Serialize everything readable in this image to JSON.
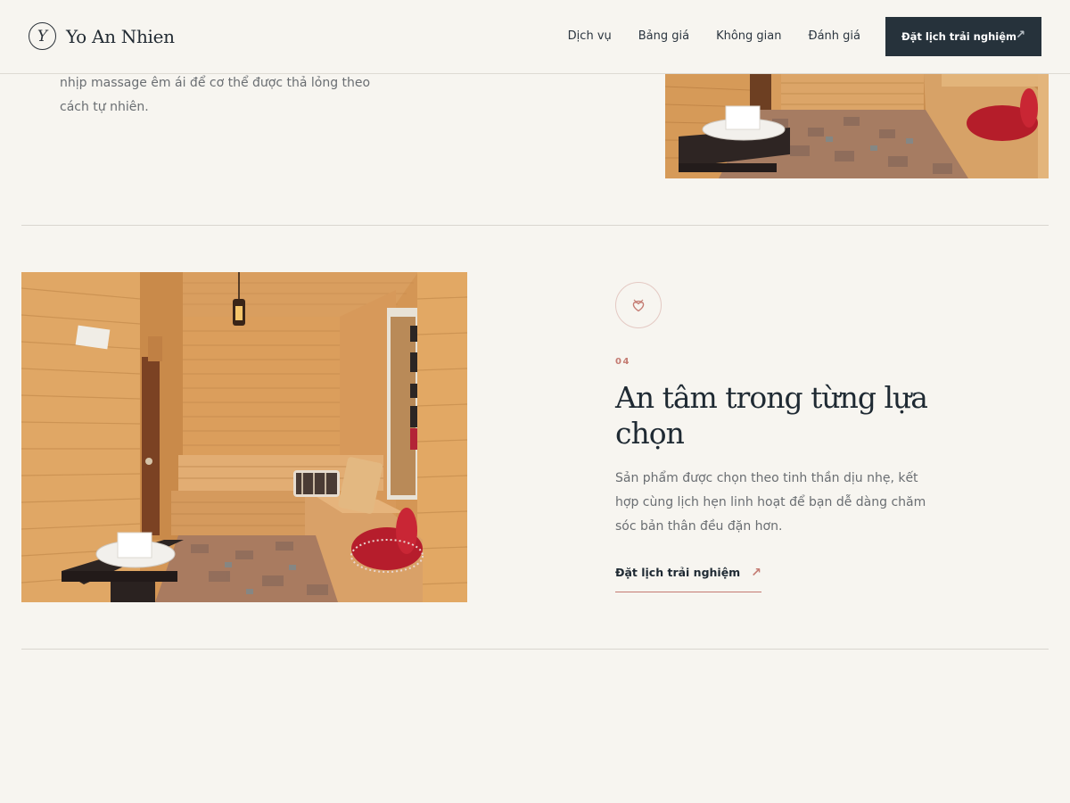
{
  "header": {
    "logo_letter": "Y",
    "brand": "Yo An Nhien",
    "nav": [
      "Dịch vụ",
      "Bảng giá",
      "Không gian",
      "Đánh giá"
    ],
    "cta_label": "Đặt lịch trải nghiệm",
    "cta_icon": "arrow-up-right-icon"
  },
  "previous_section": {
    "text": "nhịp massage êm ái để cơ thể được thả lỏng theo cách tự nhiên."
  },
  "feature": {
    "icon": "heart-shield-icon",
    "number": "04",
    "title": "An tâm trong từng lựa chọn",
    "description": "Sản phẩm được chọn theo tinh thần dịu nhẹ, kết hợp cùng lịch hẹn linh hoạt để bạn dễ dàng chăm sóc bản thân đều đặn hơn.",
    "link_label": "Đặt lịch trải nghiệm",
    "link_icon": "arrow-up-right-icon"
  },
  "colors": {
    "background": "#f7f5f0",
    "dark": "#26323b",
    "accent": "#c47b72"
  }
}
